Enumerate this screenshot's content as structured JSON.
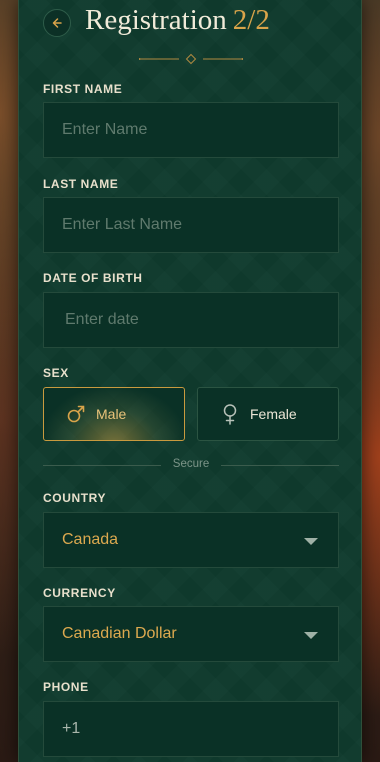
{
  "header": {
    "title": "Registration",
    "step": "2/2"
  },
  "form": {
    "first_name": {
      "label": "FIRST NAME",
      "placeholder": "Enter Name"
    },
    "last_name": {
      "label": "LAST NAME",
      "placeholder": "Enter Last Name"
    },
    "dob": {
      "label": "DATE OF BIRTH",
      "placeholder": "Enter date"
    },
    "sex": {
      "label": "SEX",
      "options": [
        {
          "label": "Male",
          "icon": "male-icon",
          "selected": true
        },
        {
          "label": "Female",
          "icon": "female-icon",
          "selected": false
        }
      ]
    },
    "secure_text": "Secure",
    "country": {
      "label": "COUNTRY",
      "value": "Canada"
    },
    "currency": {
      "label": "CURRENCY",
      "value": "Canadian Dollar"
    },
    "phone": {
      "label": "PHONE",
      "value": "+1"
    }
  },
  "colors": {
    "panel": "#0f3b2e",
    "accent": "#d9a44a",
    "field": "#0a3126"
  }
}
